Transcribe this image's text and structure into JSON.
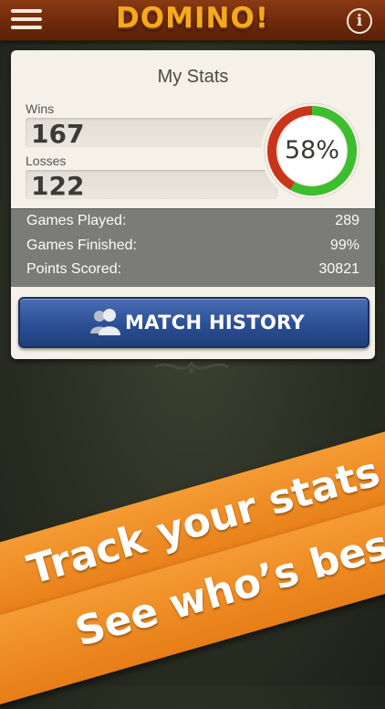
{
  "header": {
    "title": "DOMINO!",
    "menu_icon": "hamburger-menu-icon",
    "info_icon": "info-icon",
    "info_glyph": "i",
    "bar_color": "#6e2a0c",
    "title_color": "#f6a91b"
  },
  "stats": {
    "title": "My Stats",
    "wins_label": "Wins",
    "wins_value": "167",
    "losses_label": "Losses",
    "losses_value": "122",
    "win_percent_text": "58%",
    "win_fraction": 0.58,
    "win_color": "#3bbf2e",
    "loss_color": "#c9351a",
    "rows": [
      {
        "label": "Games Played:",
        "value": "289"
      },
      {
        "label": "Games Finished:",
        "value": "99%"
      },
      {
        "label": "Points Scored:",
        "value": "30821"
      }
    ]
  },
  "match_history": {
    "label": "MATCH HISTORY",
    "icon": "people-icon",
    "color": "#2b4f94"
  },
  "promo": {
    "line1": "Track your stats",
    "line2": "See who’s best!",
    "color": "#ef8a22"
  }
}
